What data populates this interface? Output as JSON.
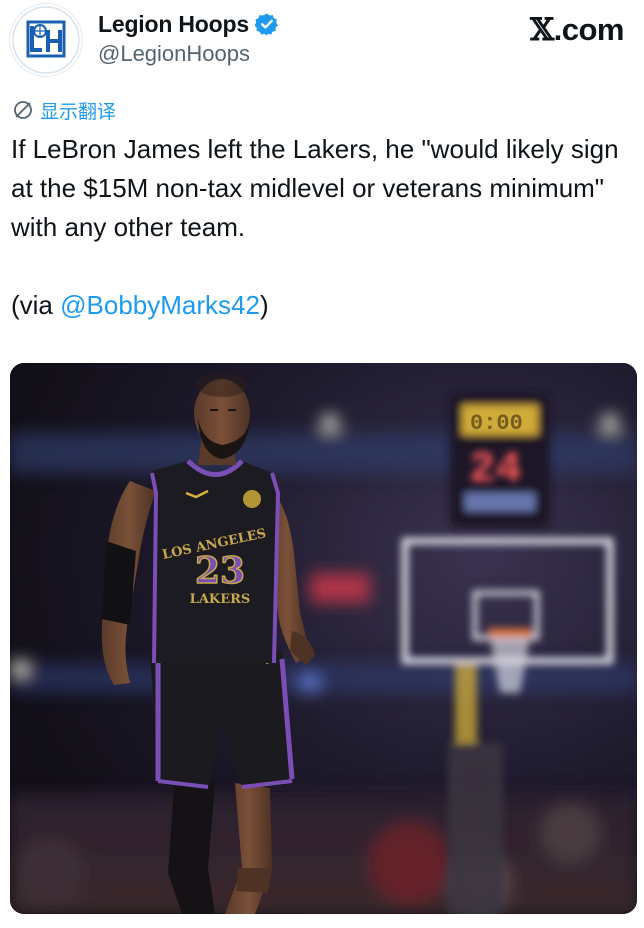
{
  "account": {
    "display_name": "Legion Hoops",
    "handle": "@LegionHoops",
    "avatar_icon": "legion-hoops-logo-icon",
    "verified_icon": "verified-badge-icon",
    "verified_color": "#1d9bf0"
  },
  "site_mark": {
    "glyph": "𝕏",
    "text": ".com"
  },
  "translate": {
    "icon": "translate-globe-icon",
    "label": "显示翻译"
  },
  "tweet": {
    "text_line1": "If LeBron James left the Lakers, he \"would likely sign at the $15M non-tax midlevel or veterans minimum\" with any other team.",
    "via_prefix": "(via ",
    "mention": "@BobbyMarks42",
    "via_suffix": ")"
  },
  "photo": {
    "jersey_team_text": "LOS ANGELES",
    "jersey_number": "23",
    "jersey_wordmark": "LAKERS",
    "shot_clock_value": "24",
    "shot_clock_top": "0:00"
  },
  "colors": {
    "link": "#1d9bf0",
    "text": "#0f1419",
    "secondary": "#536471",
    "jersey_trim": "#7a4fb5",
    "jersey_gold": "#c9a84c"
  }
}
